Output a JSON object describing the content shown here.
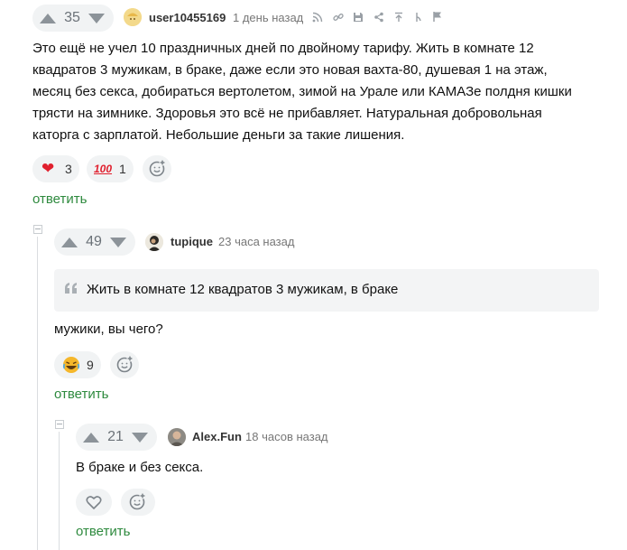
{
  "comments": [
    {
      "rating": "35",
      "username": "user10455169",
      "time": "1 день назад",
      "text": "Это ещё не учел 10 праздничных дней по двойному тарифу. Жить в комнате 12 квадратов 3 мужикам, в браке, даже если это новая вахта-80, душевая 1 на этаж, месяц без секса, добираться вертолетом, зимой на Урале или КАМАЗе полдня кишки трясти на зимнике. Здоровья это всё не прибавляет. Натуральная добровольная каторга с зарплатой. Небольшие деньги за такие лишения.",
      "reactions": [
        {
          "icon": "heart-icon",
          "glyph": "❤",
          "count": "3"
        },
        {
          "icon": "hundred-points-icon",
          "glyph": "💯",
          "count": "1"
        }
      ],
      "reply_label": "ответить"
    },
    {
      "rating": "49",
      "username": "tupique",
      "time": "23 часа назад",
      "quote": "Жить в комнате 12 квадратов 3 мужикам, в браке",
      "text": "мужики, вы чего?",
      "reactions": [
        {
          "icon": "laughing-face-icon",
          "glyph": "😂",
          "count": "9"
        }
      ],
      "reply_label": "ответить"
    },
    {
      "rating": "21",
      "username": "Alex.Fun",
      "time": "18 часов назад",
      "text": "В браке и без секса.",
      "reply_label": "ответить"
    }
  ],
  "colors": {
    "reply_link": "#2e8a3e",
    "pill_bg": "#f1f3f4",
    "heart": "#e0202e"
  }
}
